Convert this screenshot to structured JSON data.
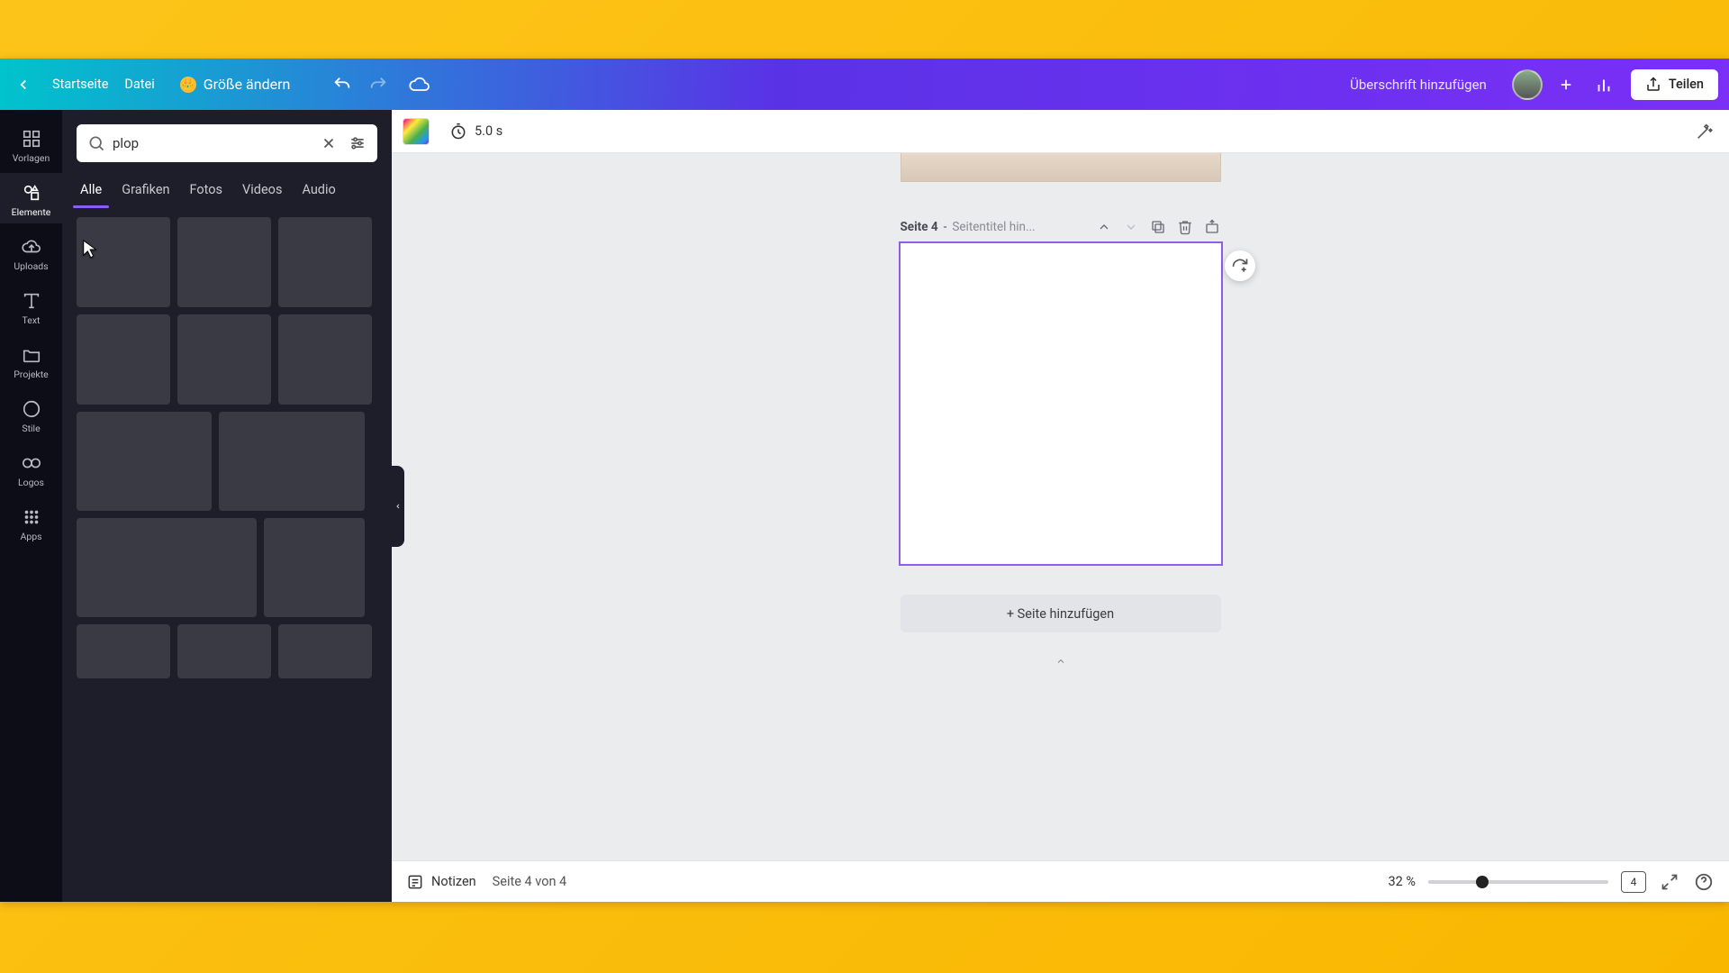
{
  "topbar": {
    "home": "Startseite",
    "file": "Datei",
    "resize": "Größe ändern",
    "title_placeholder": "Überschrift hinzufügen",
    "share": "Teilen"
  },
  "rail": {
    "templates": "Vorlagen",
    "elements": "Elemente",
    "uploads": "Uploads",
    "text": "Text",
    "projects": "Projekte",
    "styles": "Stile",
    "logos": "Logos",
    "apps": "Apps"
  },
  "search": {
    "value": "plop"
  },
  "tabs": {
    "all": "Alle",
    "graphics": "Grafiken",
    "photos": "Fotos",
    "videos": "Videos",
    "audio": "Audio"
  },
  "context": {
    "duration": "5.0 s"
  },
  "page": {
    "label": "Seite 4",
    "sep": " - ",
    "subtitle": "Seitentitel hin...",
    "add": "+ Seite hinzufügen"
  },
  "status": {
    "notes": "Notizen",
    "page_of": "Seite 4 von 4",
    "zoom": "32 %",
    "page_badge": "4"
  }
}
